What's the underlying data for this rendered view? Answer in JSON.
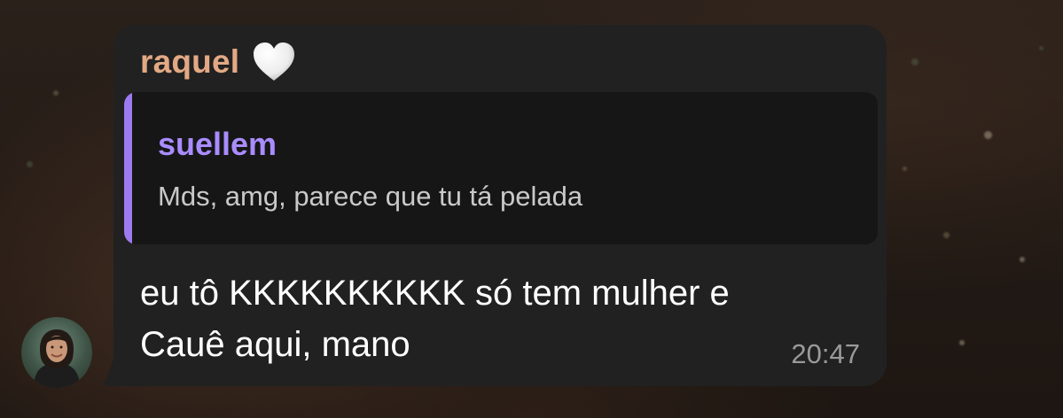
{
  "message": {
    "sender": {
      "name": "raquel",
      "name_color": "#e3a984",
      "badge_icon": "white-heart-icon"
    },
    "reply": {
      "author": "suellem",
      "author_color": "#a98cff",
      "text": "Mds, amg, parece que tu tá pelada"
    },
    "text_line_1": "eu tô KKKKKKKKKK só tem mulher e",
    "text_line_2": "Cauê aqui, mano",
    "time": "20:47",
    "avatar_icon": "user-avatar"
  },
  "theme": {
    "bubble_color": "#212121",
    "reply_bg": "#161616",
    "reply_accent": "#9d7af0",
    "text_color": "#ffffff",
    "time_color": "#9a9a9a"
  }
}
